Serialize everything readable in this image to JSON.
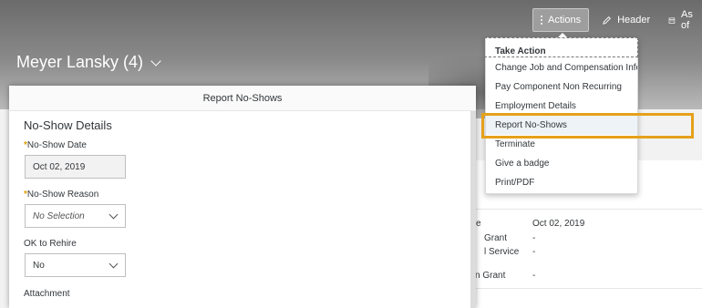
{
  "toolbar": {
    "actions_label": "Actions",
    "header_label": "Header",
    "as_of_label": "As of"
  },
  "header": {
    "person_title": "Meyer Lansky (4)"
  },
  "menu": {
    "heading": "Take Action",
    "items": [
      "Change Job and Compensation Info",
      "Pay Component Non Recurring",
      "Employment Details",
      "Report No-Shows",
      "Terminate",
      "Give a badge",
      "Print/PDF"
    ],
    "selected_index": 3
  },
  "background_details": {
    "rows": [
      {
        "label": "e",
        "value": "Oct 02, 2019"
      },
      {
        "label": "Grant",
        "value": "-"
      },
      {
        "label": "l Service",
        "value": "-"
      },
      {
        "label": "n Grant",
        "value": "-"
      }
    ]
  },
  "dialog": {
    "title": "Report No-Shows",
    "section_title": "No-Show Details",
    "fields": {
      "no_show_date": {
        "required_mark": "*",
        "label": "No-Show Date",
        "value": "Oct 02, 2019"
      },
      "no_show_reason": {
        "required_mark": "*",
        "label": "No-Show Reason",
        "value": "No Selection"
      },
      "ok_to_rehire": {
        "label": "OK to Rehire",
        "value": "No"
      },
      "attachment": {
        "label": "Attachment"
      }
    }
  },
  "colors": {
    "highlight": "#e5a11a",
    "required": "#e09d00"
  }
}
